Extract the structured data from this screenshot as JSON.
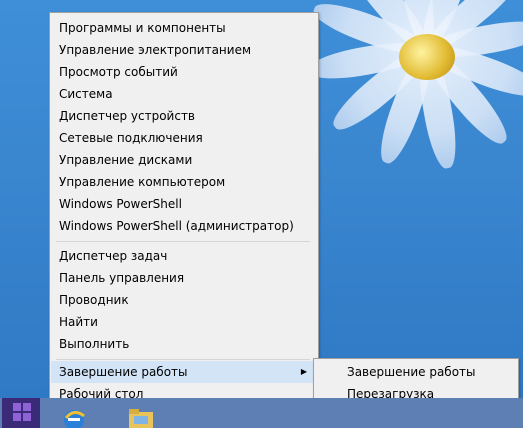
{
  "menu": {
    "items": [
      {
        "label": "Программы и компоненты"
      },
      {
        "label": "Управление электропитанием"
      },
      {
        "label": "Просмотр событий"
      },
      {
        "label": "Система"
      },
      {
        "label": "Диспетчер устройств"
      },
      {
        "label": "Сетевые подключения"
      },
      {
        "label": "Управление дисками"
      },
      {
        "label": "Управление компьютером"
      },
      {
        "label": "Windows PowerShell"
      },
      {
        "label": "Windows PowerShell (администратор)"
      },
      {
        "label": "Диспетчер задач"
      },
      {
        "label": "Панель управления"
      },
      {
        "label": "Проводник"
      },
      {
        "label": "Найти"
      },
      {
        "label": "Выполнить"
      },
      {
        "label": "Завершение работы"
      },
      {
        "label": "Рабочий стол"
      }
    ]
  },
  "submenu": {
    "items": [
      {
        "label": "Завершение работы"
      },
      {
        "label": "Перезагрузка"
      }
    ]
  },
  "colors": {
    "menu_bg": "#f0f0f0",
    "highlight": "#d2e4f6",
    "desktop": "#3a86cf",
    "start_button": "#3b2a78"
  },
  "icons": {
    "start": "windows-logo-icon",
    "taskbar_1": "internet-explorer-icon",
    "taskbar_2": "file-explorer-icon",
    "submenu_arrow": "chevron-right-icon"
  }
}
